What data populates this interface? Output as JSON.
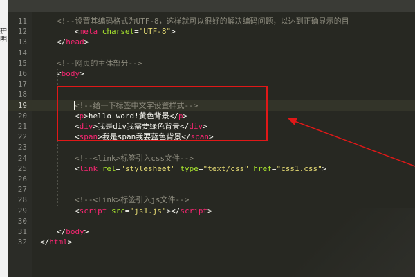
{
  "left_strip": {
    "fragments": [
      "·",
      "护",
      "明"
    ]
  },
  "current_line": 19,
  "lines": [
    {
      "n": 11,
      "indent": 1,
      "segments": [
        {
          "t": "<!--设置其编码格式为UTF-8，这样就可以很好的解决编码问题，以达到正确显示的目",
          "k": "comment"
        }
      ]
    },
    {
      "n": 12,
      "indent": 2,
      "segments": [
        {
          "t": "<",
          "k": "punc"
        },
        {
          "t": "meta",
          "k": "tag"
        },
        {
          "t": " ",
          "k": "punc"
        },
        {
          "t": "charset",
          "k": "attr"
        },
        {
          "t": "=",
          "k": "punc"
        },
        {
          "t": "\"UTF-8\"",
          "k": "str"
        },
        {
          "t": ">",
          "k": "punc"
        }
      ]
    },
    {
      "n": 13,
      "indent": 1,
      "segments": [
        {
          "t": "</",
          "k": "punc"
        },
        {
          "t": "head",
          "k": "tag"
        },
        {
          "t": ">",
          "k": "punc"
        }
      ]
    },
    {
      "n": 14,
      "indent": 0,
      "segments": []
    },
    {
      "n": 15,
      "indent": 1,
      "segments": [
        {
          "t": "<!--网页的主体部分-->",
          "k": "comment"
        }
      ]
    },
    {
      "n": 16,
      "indent": 1,
      "segments": [
        {
          "t": "<",
          "k": "punc"
        },
        {
          "t": "body",
          "k": "tag"
        },
        {
          "t": ">",
          "k": "punc"
        }
      ]
    },
    {
      "n": 17,
      "indent": 0,
      "segments": []
    },
    {
      "n": 18,
      "indent": 0,
      "segments": []
    },
    {
      "n": 19,
      "indent": 2,
      "segments": [
        {
          "t": "<!--给一下标签中文字设置样式-->",
          "k": "comment"
        }
      ]
    },
    {
      "n": 20,
      "indent": 2,
      "segments": [
        {
          "t": "<",
          "k": "punc"
        },
        {
          "t": "p",
          "k": "tag"
        },
        {
          "t": ">hello word!黄色背景</",
          "k": "punc"
        },
        {
          "t": "p",
          "k": "tag"
        },
        {
          "t": ">",
          "k": "punc"
        }
      ]
    },
    {
      "n": 21,
      "indent": 2,
      "segments": [
        {
          "t": "<",
          "k": "punc"
        },
        {
          "t": "div",
          "k": "tag"
        },
        {
          "t": ">我是div我需要绿色背景</",
          "k": "punc"
        },
        {
          "t": "div",
          "k": "tag"
        },
        {
          "t": ">",
          "k": "punc"
        }
      ]
    },
    {
      "n": 22,
      "indent": 2,
      "segments": [
        {
          "t": "<",
          "k": "punc"
        },
        {
          "t": "span",
          "k": "tag"
        },
        {
          "t": ">我是span我要蓝色背景</",
          "k": "punc"
        },
        {
          "t": "span",
          "k": "tag"
        },
        {
          "t": ">",
          "k": "punc"
        }
      ]
    },
    {
      "n": 23,
      "indent": 0,
      "segments": []
    },
    {
      "n": 24,
      "indent": 2,
      "segments": [
        {
          "t": "<!--<link>标签引入css文件-->",
          "k": "comment"
        }
      ]
    },
    {
      "n": 25,
      "indent": 2,
      "segments": [
        {
          "t": "<",
          "k": "punc"
        },
        {
          "t": "link",
          "k": "tag"
        },
        {
          "t": " ",
          "k": "punc"
        },
        {
          "t": "rel",
          "k": "attr"
        },
        {
          "t": "=",
          "k": "punc"
        },
        {
          "t": "\"stylesheet\"",
          "k": "str"
        },
        {
          "t": " ",
          "k": "punc"
        },
        {
          "t": "type",
          "k": "attr"
        },
        {
          "t": "=",
          "k": "punc"
        },
        {
          "t": "\"text/css\"",
          "k": "str"
        },
        {
          "t": " ",
          "k": "punc"
        },
        {
          "t": "href",
          "k": "attr"
        },
        {
          "t": "=",
          "k": "punc"
        },
        {
          "t": "\"css1.css\"",
          "k": "str"
        },
        {
          "t": ">",
          "k": "punc"
        }
      ]
    },
    {
      "n": 26,
      "indent": 0,
      "segments": []
    },
    {
      "n": 27,
      "indent": 0,
      "segments": []
    },
    {
      "n": 28,
      "indent": 2,
      "segments": [
        {
          "t": "<!--<link>标签引入js文件-->",
          "k": "comment"
        }
      ]
    },
    {
      "n": 29,
      "indent": 2,
      "segments": [
        {
          "t": "<",
          "k": "punc"
        },
        {
          "t": "script",
          "k": "tag"
        },
        {
          "t": " ",
          "k": "punc"
        },
        {
          "t": "src",
          "k": "attr"
        },
        {
          "t": "=",
          "k": "punc"
        },
        {
          "t": "\"js1.js\"",
          "k": "str"
        },
        {
          "t": "></",
          "k": "punc"
        },
        {
          "t": "script",
          "k": "tag"
        },
        {
          "t": ">",
          "k": "punc"
        }
      ]
    },
    {
      "n": 30,
      "indent": 0,
      "segments": []
    },
    {
      "n": 31,
      "indent": 1,
      "segments": [
        {
          "t": "</",
          "k": "punc"
        },
        {
          "t": "body",
          "k": "tag"
        },
        {
          "t": ">",
          "k": "punc"
        }
      ]
    },
    {
      "n": 32,
      "indent": 0,
      "segments": [
        {
          "t": "</",
          "k": "punc"
        },
        {
          "t": "html",
          "k": "tag"
        },
        {
          "t": ">",
          "k": "punc"
        }
      ]
    }
  ],
  "colors": {
    "editor_bg": "#272822",
    "tag": "#f92672",
    "attribute": "#a6e22e",
    "string": "#e6db74",
    "comment": "#8d8b7e",
    "text": "#f8f8f2",
    "annotation_red": "#e01818"
  }
}
